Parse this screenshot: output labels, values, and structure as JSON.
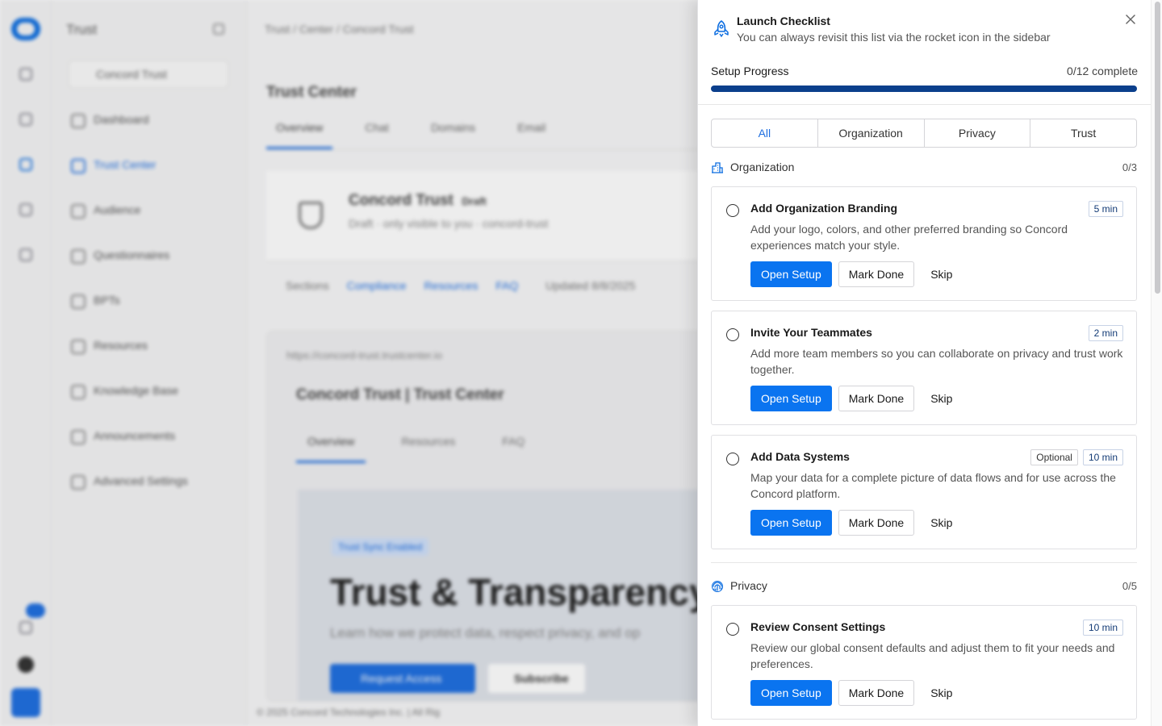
{
  "background": {
    "sidebar_title": "Trust",
    "org_selector": "Concord Trust",
    "nav": [
      "Dashboard",
      "Trust Center",
      "Audience",
      "Questionnaires",
      "BPTs",
      "Resources",
      "Knowledge Base",
      "Announcements",
      "Advanced Settings"
    ],
    "active_nav": "Trust Center",
    "breadcrumb": "Trust  /  Center  /  Concord Trust",
    "page_title": "Trust Center",
    "tabs": [
      "Overview",
      "Chat",
      "Domains",
      "Email"
    ],
    "card_title": "Concord Trust",
    "card_badge": "Draft",
    "card_sub": "Draft · only visible to you · concord-trust",
    "sections_label": "Sections",
    "section_links": [
      "Compliance",
      "Resources",
      "FAQ"
    ],
    "updated": "Updated 8/8/2025",
    "preview_url": "https://concord-trust.trustcenter.io",
    "preview_header": "Concord Trust  |  Trust Center",
    "preview_tabs": [
      "Overview",
      "Resources",
      "FAQ"
    ],
    "hero_pill": "Trust Sync Enabled",
    "hero_title": "Trust & Transparency",
    "hero_sub": "Learn how we protect data, respect privacy, and op",
    "hero_btn_primary": "Request Access",
    "hero_btn_secondary": "Subscribe",
    "footer": "© 2025 Concord Technologies Inc. | All Rig"
  },
  "panel": {
    "title": "Launch Checklist",
    "subtitle": "You can always revisit this list via the rocket icon in the sidebar",
    "progress_label": "Setup Progress",
    "progress_count": "0/12 complete",
    "progress_fraction": 0,
    "filters": [
      "All",
      "Organization",
      "Privacy",
      "Trust"
    ],
    "active_filter": "All",
    "groups": [
      {
        "label": "Organization",
        "count": "0/3",
        "icon": "building-icon",
        "tasks": [
          {
            "title": "Add Organization Branding",
            "description": "Add your logo, colors, and other preferred branding so Concord experiences match your style.",
            "tags": [
              "5 min"
            ]
          },
          {
            "title": "Invite Your Teammates",
            "description": "Add more team members so you can collaborate on privacy and trust work together.",
            "tags": [
              "2 min"
            ]
          },
          {
            "title": "Add Data Systems",
            "description": "Map your data for a complete picture of data flows and for use across the Concord platform.",
            "tags": [
              "Optional",
              "10 min"
            ]
          }
        ]
      },
      {
        "label": "Privacy",
        "count": "0/5",
        "icon": "fingerprint-icon",
        "tasks": [
          {
            "title": "Review Consent Settings",
            "description": "Review our global consent defaults and adjust them to fit your needs and preferences.",
            "tags": [
              "10 min"
            ]
          }
        ]
      }
    ],
    "actions": {
      "open": "Open Setup",
      "done": "Mark Done",
      "skip": "Skip"
    }
  }
}
